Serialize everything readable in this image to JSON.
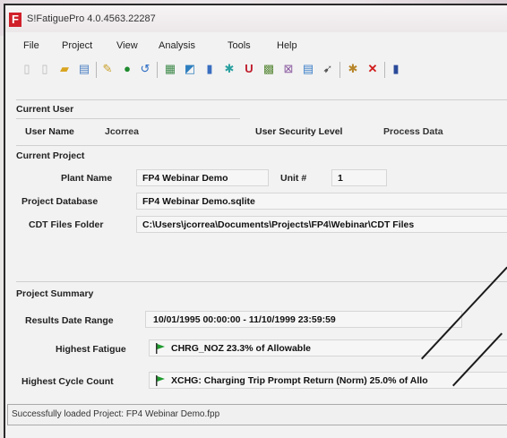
{
  "window": {
    "title": "S!FatiguePro 4.0.4563.22287"
  },
  "menu": [
    "File",
    "Project",
    "View",
    "Analysis",
    "Tools",
    "Help"
  ],
  "toolbar_icons": [
    "new-icon",
    "open-icon",
    "folder-icon",
    "document-icon",
    "edit-icon",
    "run-icon",
    "undo-icon",
    "table-icon",
    "chart-icon",
    "bar-chart-icon",
    "star-icon",
    "magnet-icon",
    "grid-icon",
    "report-icon",
    "list-icon",
    "pin-icon",
    "settings-icon",
    "delete-icon",
    "exit-icon"
  ],
  "current_user": {
    "header": "Current User",
    "user_name_label": "User Name",
    "user_name": "Jcorrea",
    "security_label": "User Security Level",
    "security_level": "Process Data"
  },
  "current_project": {
    "header": "Current Project",
    "plant_label": "Plant Name",
    "plant_name": "FP4 Webinar Demo",
    "unit_label": "Unit #",
    "unit": "1",
    "db_label": "Project Database",
    "db": "FP4 Webinar Demo.sqlite",
    "cdt_label": "CDT Files Folder",
    "cdt": "C:\\Users\\jcorrea\\Documents\\Projects\\FP4\\Webinar\\CDT Files"
  },
  "summary": {
    "header": "Project Summary",
    "range_label": "Results Date Range",
    "range": "10/01/1995 00:00:00 - 11/10/1999 23:59:59",
    "fatigue_label": "Highest Fatigue",
    "fatigue": "CHRG_NOZ 23.3% of Allowable",
    "cycle_label": "Highest Cycle Count",
    "cycle": "XCHG: Charging Trip Prompt Return (Norm) 25.0% of Allo"
  },
  "status": "Successfully loaded Project: FP4 Webinar Demo.fpp",
  "colors": {
    "flag": "#1f9a2e",
    "app_icon": "#d0202a"
  }
}
